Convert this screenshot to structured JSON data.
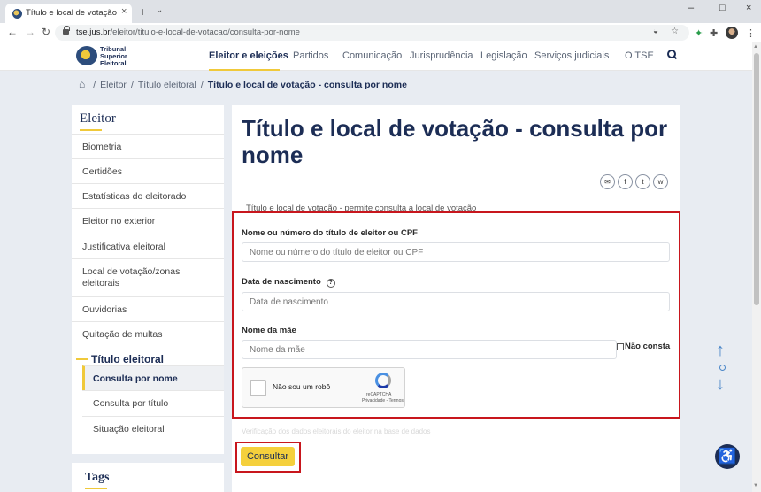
{
  "browser": {
    "tab_title": "Título e local de votação - cons",
    "tab_close": "×",
    "new_tab": "+",
    "tab_dropdown": "⌄",
    "window_controls": {
      "minimize": "–",
      "maximize": "□",
      "close": "×"
    },
    "nav": {
      "back": "←",
      "forward": "→",
      "reload": "↻"
    },
    "url_domain": "tse.jus.br",
    "url_path": "/eleitor/titulo-e-local-de-votacao/consulta-por-nome",
    "icons": [
      "translate-icon",
      "star-icon",
      "extension-icon",
      "puzzle-icon",
      "profile-avatar"
    ]
  },
  "site": {
    "logo_lines": [
      "Tribunal",
      "Superior",
      "Eleitoral"
    ],
    "nav_items": [
      "Eleitor e eleições",
      "Partidos",
      "Comunicação",
      "Jurisprudência",
      "Legislação",
      "Serviços judiciais",
      "O TSE"
    ],
    "active_nav": "Eleitor e eleições"
  },
  "breadcrumb": {
    "items": [
      "Eleitor",
      "Título eleitoral"
    ],
    "current": "Título e local de votação - consulta por nome"
  },
  "sidebar": {
    "title": "Eleitor",
    "items": [
      "Biometria",
      "Certidões",
      "Estatísticas do eleitorado",
      "Eleitor no exterior",
      "Justificativa eleitoral",
      "Local de votação/zonas eleitorais",
      "Ouvidorias",
      "Quitação de multas"
    ],
    "subsection": "Título eleitoral",
    "sub_items": [
      "Consulta por nome",
      "Consulta por título",
      "Situação eleitoral"
    ],
    "active_sub": "Consulta por nome",
    "tags_title": "Tags"
  },
  "main": {
    "title": "Título e local de votação - consulta por nome",
    "share_icons": [
      "✉",
      "f",
      "t",
      "w"
    ],
    "intro": "Título e local de votação - permite consulta a local de votação",
    "form": {
      "name_label": "Nome ou número do título de eleitor ou CPF",
      "name_placeholder": "Nome ou número do título de eleitor ou CPF",
      "birth_label": "Data de nascimento",
      "birth_help": "?",
      "birth_placeholder": "Data de nascimento",
      "mother_label": "Nome da mãe",
      "mother_placeholder": "Nome da mãe",
      "not_listed_label": "Não consta",
      "recaptcha_label": "Não sou um robô",
      "recaptcha_brand": "reCAPTCHA",
      "recaptcha_terms": "Privacidade - Termos",
      "faded_note": "Verificação dos dados eleitorais do eleitor na base de dados"
    },
    "submit_label": "Consultar"
  },
  "floating": {
    "up_arrow": "↑",
    "down_arrow": "↓",
    "accessibility": "♿"
  }
}
